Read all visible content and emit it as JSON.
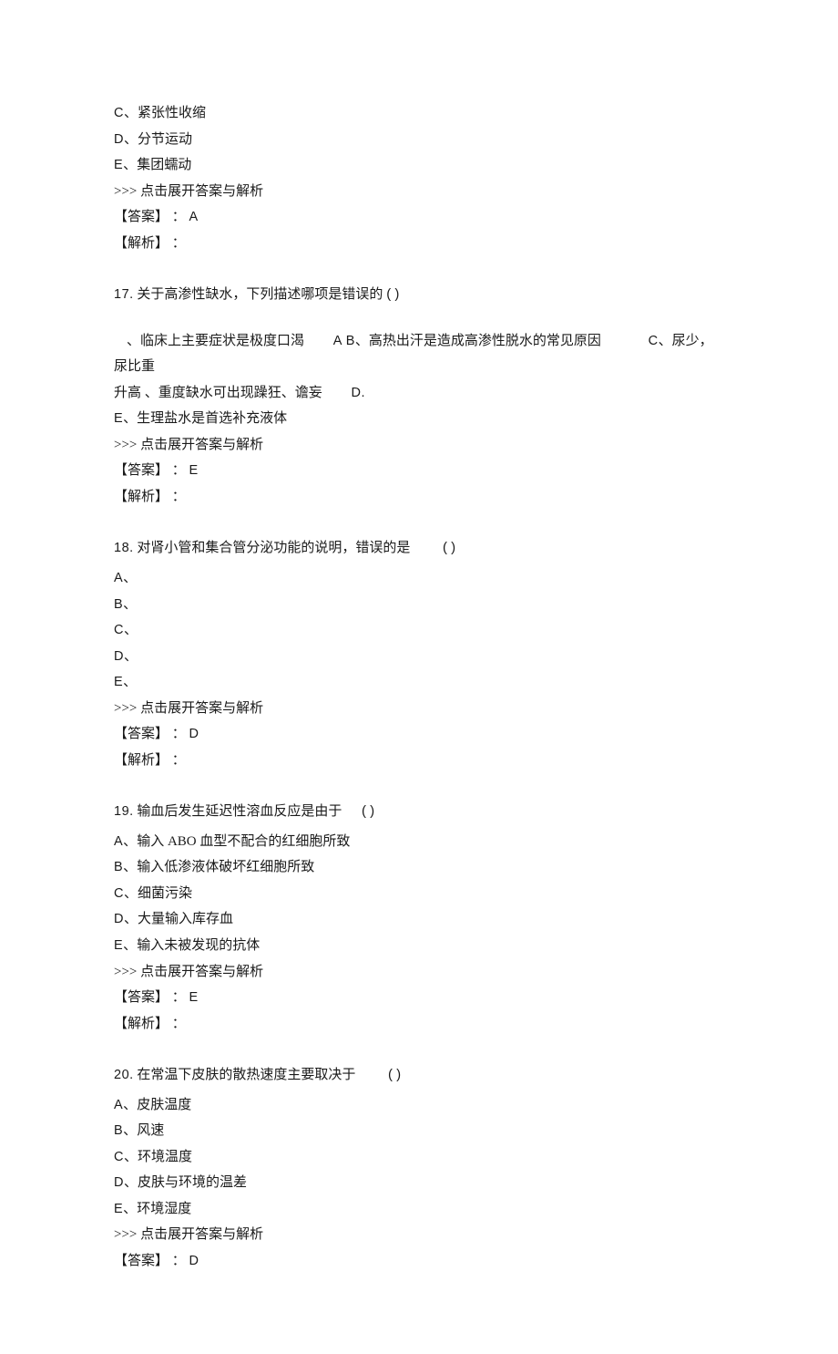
{
  "q16_tail": {
    "opts": [
      {
        "tag": "C",
        "text": "紧张性收缩"
      },
      {
        "tag": "D",
        "text": "分节运动"
      },
      {
        "tag": "E",
        "text": "集团蠕动"
      }
    ],
    "link": ">>> 点击展开答案与解析",
    "ans_label": "【答案】 ：",
    "ans": "A",
    "exp_label": "【解析】 ："
  },
  "q17": {
    "num": "17.",
    "stem": "关于高渗性缺水，下列描述哪项是错误的",
    "paren": "( )",
    "optsLine1_a": "、临床上主要症状是极度口渴",
    "optsLine1_a_tag": "A",
    "optsLine1_b_tag": "B",
    "optsLine1_b": "、高热出汗是造成高渗性脱水的常见原因",
    "optsLine1_c_tag": "C",
    "optsLine1_c": "、尿少，尿比重",
    "optsLine2_a": "升高  、重度缺水可出现躁狂、谵妄",
    "optsLine2_d_tag": "D.",
    "optE_tag": "E",
    "optE_text": "、生理盐水是首选补充液体",
    "link": ">>> 点击展开答案与解析",
    "ans_label": "【答案】 ：",
    "ans": "E",
    "exp_label": "【解析】 ："
  },
  "q18": {
    "num": "18.",
    "stem": "对肾小管和集合管分泌功能的说明，错误的是",
    "paren": "( )",
    "opts": [
      {
        "tag": "A",
        "text": ""
      },
      {
        "tag": "B",
        "text": ""
      },
      {
        "tag": "C",
        "text": ""
      },
      {
        "tag": "D",
        "text": ""
      },
      {
        "tag": "E",
        "text": ""
      }
    ],
    "link": ">>> 点击展开答案与解析",
    "ans_label": "【答案】 ：",
    "ans": "D",
    "exp_label": "【解析】 ："
  },
  "q19": {
    "num": "19.",
    "stem": "输血后发生延迟性溶血反应是由于",
    "paren": "( )",
    "opts": [
      {
        "tag": "A",
        "text": "输入 ABO 血型不配合的红细胞所致"
      },
      {
        "tag": "B",
        "text": "输入低渗液体破坏红细胞所致"
      },
      {
        "tag": "C",
        "text": "细菌污染"
      },
      {
        "tag": "D",
        "text": "大量输入库存血"
      },
      {
        "tag": "E",
        "text": "输入未被发现的抗体"
      }
    ],
    "link": ">>> 点击展开答案与解析",
    "ans_label": "【答案】 ：",
    "ans": "E",
    "exp_label": "【解析】 ："
  },
  "q20": {
    "num": "20.",
    "stem": "在常温下皮肤的散热速度主要取决于",
    "paren": "( )",
    "opts": [
      {
        "tag": "A",
        "text": "皮肤温度"
      },
      {
        "tag": "B",
        "text": "风速"
      },
      {
        "tag": "C",
        "text": "环境温度"
      },
      {
        "tag": "D",
        "text": "皮肤与环境的温差"
      },
      {
        "tag": "E",
        "text": "环境湿度"
      }
    ],
    "link": ">>> 点击展开答案与解析",
    "ans_label": "【答案】 ：",
    "ans": "D",
    "exp_label": "【解析】 ："
  }
}
